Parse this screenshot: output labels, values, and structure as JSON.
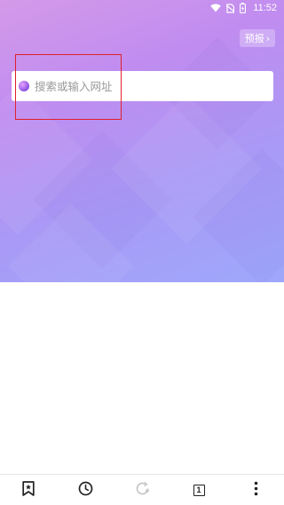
{
  "status_bar": {
    "time": "11:52"
  },
  "header": {
    "forecast_label": "预报",
    "forecast_chevron": "›"
  },
  "search": {
    "placeholder": "搜索或输入网址",
    "value": ""
  },
  "toolbar": {
    "tab_count": "1",
    "items": [
      "bookmark-icon",
      "history-icon",
      "refresh-icon",
      "tabs-icon",
      "more-icon"
    ]
  },
  "colors": {
    "gradient_start": "#d49ae8",
    "gradient_end": "#9ea8fb",
    "highlight": "#e0202a"
  }
}
